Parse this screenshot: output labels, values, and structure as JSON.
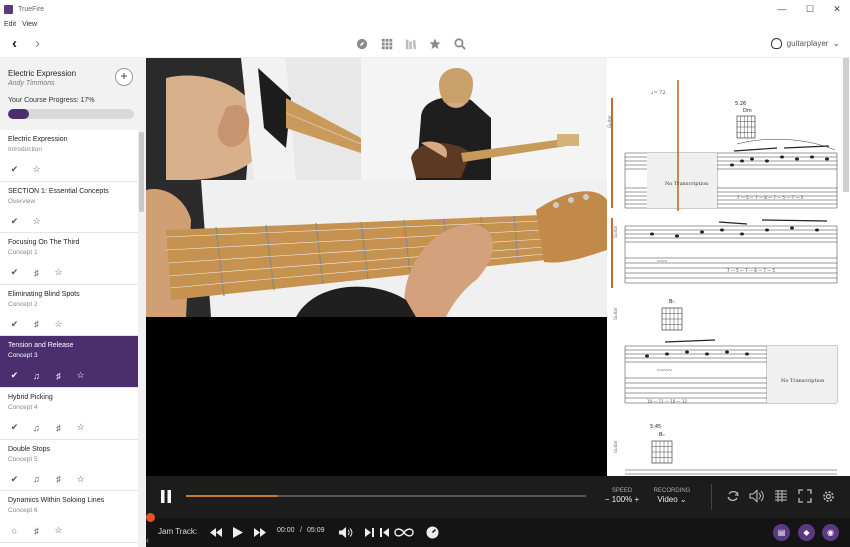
{
  "app": {
    "title": "TrueFire"
  },
  "window_controls": {
    "minimize": "—",
    "maximize": "☐",
    "close": "✕"
  },
  "menu": [
    "Edit",
    "View"
  ],
  "toolbar": {
    "back_glyph": "‹",
    "forward_glyph": "›",
    "icons": [
      "compass-icon",
      "grid-icon",
      "library-icon",
      "star-icon",
      "search-icon"
    ],
    "user": "guitarplayer",
    "user_chevron": "⌄"
  },
  "course": {
    "title": "Electric Expression",
    "author": "Andy Timmons",
    "add_glyph": "+",
    "progress_label": "Your Course Progress: 17%",
    "progress": 0.17
  },
  "lessons": [
    {
      "title": "Electric Expression",
      "subtitle": "Introduction",
      "icons": [
        "check",
        "star"
      ],
      "active": false
    },
    {
      "title": "SECTION 1: Essential Concepts",
      "subtitle": "Overview",
      "icons": [
        "check",
        "star"
      ],
      "active": false
    },
    {
      "title": "Focusing On The Third",
      "subtitle": "Concept 1",
      "icons": [
        "check",
        "tab",
        "star"
      ],
      "active": false
    },
    {
      "title": "Eliminating Blind Spots",
      "subtitle": "Concept 2",
      "icons": [
        "check",
        "tab",
        "star"
      ],
      "active": false
    },
    {
      "title": "Tension and Release",
      "subtitle": "Concept 3",
      "icons": [
        "check",
        "music",
        "tab",
        "star"
      ],
      "active": true
    },
    {
      "title": "Hybrid Picking",
      "subtitle": "Concept 4",
      "icons": [
        "check",
        "music",
        "tab",
        "star"
      ],
      "active": false
    },
    {
      "title": "Double Stops",
      "subtitle": "Concept 5",
      "icons": [
        "check",
        "music",
        "tab",
        "star"
      ],
      "active": false
    },
    {
      "title": "Dynamics Within Soloing Lines",
      "subtitle": "Concept 6",
      "icons": [
        "circle",
        "tab",
        "star"
      ],
      "active": false
    }
  ],
  "notation": {
    "tempo": "♩= 72",
    "time_1": "5:26",
    "time_2": "5:45",
    "chord_1": "Dm",
    "chord_2": "B♭",
    "chord_3": "B♭",
    "no_transcription": "No Transcription",
    "staff_label": "Guitar"
  },
  "player": {
    "playback_progress": 0.23,
    "speed_label": "SPEED",
    "speed_value": "100%",
    "speed_minus": "−",
    "speed_plus": "+",
    "recording_label": "RECORDING",
    "recording_value": "Video",
    "recording_chevron": "⌄",
    "jam_label": "Jam Track:",
    "time_current": "00:00",
    "time_sep": "/",
    "time_total": "05:09"
  },
  "colors": {
    "accent": "#4a2e6e",
    "progress": "#c87a2b",
    "badge": "#5b3a82"
  }
}
